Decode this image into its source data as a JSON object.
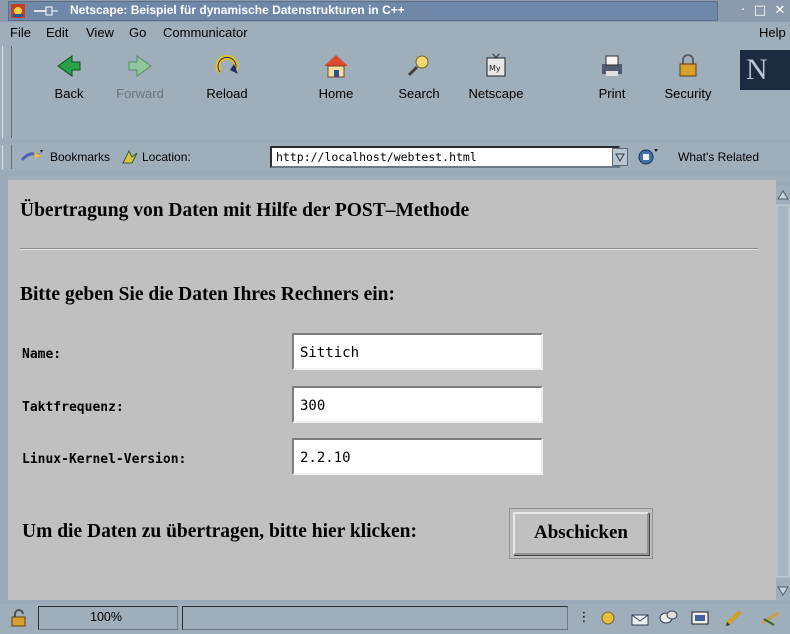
{
  "window": {
    "title": "Netscape: Beispiel für dynamische Datenstrukturen in C++"
  },
  "menu": {
    "items": [
      "File",
      "Edit",
      "View",
      "Go",
      "Communicator"
    ],
    "help": "Help"
  },
  "toolbar": {
    "buttons": [
      {
        "label": "Back",
        "icon": "back-arrow-icon"
      },
      {
        "label": "Forward",
        "icon": "forward-arrow-icon"
      },
      {
        "label": "Reload",
        "icon": "reload-icon"
      },
      {
        "label": "Home",
        "icon": "home-icon"
      },
      {
        "label": "Search",
        "icon": "search-icon"
      },
      {
        "label": "Netscape",
        "icon": "my-netscape-icon"
      },
      {
        "label": "Print",
        "icon": "print-icon"
      },
      {
        "label": "Security",
        "icon": "lock-icon"
      }
    ],
    "logo": "N"
  },
  "location_bar": {
    "bookmarks": "Bookmarks",
    "location_label": "Location:",
    "url": "http://localhost/webtest.html",
    "whats_related": "What's Related"
  },
  "page": {
    "heading": "Übertragung von Daten mit Hilfe der POST–Methode",
    "subheading": "Bitte geben Sie die Daten Ihres Rechners ein:",
    "fields": [
      {
        "label": "Name:",
        "value": "Sittich"
      },
      {
        "label": "Taktfrequenz:",
        "value": "300"
      },
      {
        "label": "Linux-Kernel-Version:",
        "value": "2.2.10"
      }
    ],
    "submit_prompt": "Um die Daten zu übertragen, bitte hier klicken:",
    "submit_label": "Abschicken"
  },
  "status": {
    "zoom": "100%"
  },
  "colors": {
    "chrome": "#9eaebb",
    "title_active": "#6f88a8",
    "content_bg": "#c0c0c0"
  }
}
